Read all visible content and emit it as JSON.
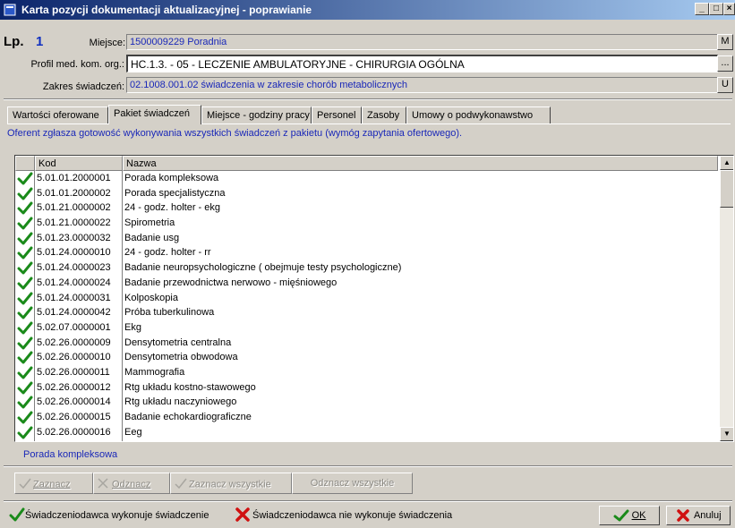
{
  "window": {
    "title": "Karta pozycji dokumentacji aktualizacyjnej - poprawianie",
    "controls": {
      "minimize": "_",
      "maximize": "□",
      "close": "×"
    }
  },
  "header": {
    "lp_label": "Lp.",
    "lp_value": "1",
    "miejsce_label": "Miejsce:",
    "miejsce_value": "1500009229 Poradnia",
    "miejsce_button": "M",
    "profil_label": "Profil med. kom. org.:",
    "profil_value": "HC.1.3. - 05 - LECZENIE AMBULATORYJNE - CHIRURGIA OGÓLNA",
    "profil_button": "...",
    "zakres_label": "Zakres świadczeń:",
    "zakres_value": "02.1008.001.02 świadczenia w zakresie chorób metabolicznych",
    "zakres_button": "U"
  },
  "tabs": [
    {
      "label": "Wartości oferowane"
    },
    {
      "label": "Pakiet świadczeń"
    },
    {
      "label": "Miejsce - godziny pracy"
    },
    {
      "label": "Personel"
    },
    {
      "label": "Zasoby"
    },
    {
      "label": "Umowy o podwykonawstwo"
    }
  ],
  "active_tab": "Pakiet świadczeń",
  "info_text": "Oferent zgłasza gotowość wykonywania wszystkich świadczeń z pakietu (wymóg zapytania ofertowego).",
  "table": {
    "columns": {
      "code": "Kod",
      "name": "Nazwa"
    },
    "rows": [
      {
        "code": "5.01.01.2000001",
        "name": "Porada kompleksowa",
        "checked": true
      },
      {
        "code": "5.01.01.2000002",
        "name": "Porada specjalistyczna",
        "checked": true
      },
      {
        "code": "5.01.21.0000002",
        "name": "24 - godz. holter - ekg",
        "checked": true
      },
      {
        "code": "5.01.21.0000022",
        "name": "Spirometria",
        "checked": true
      },
      {
        "code": "5.01.23.0000032",
        "name": "Badanie usg",
        "checked": true
      },
      {
        "code": "5.01.24.0000010",
        "name": "24 - godz. holter - rr",
        "checked": true
      },
      {
        "code": "5.01.24.0000023",
        "name": "Badanie neuropsychologiczne ( obejmuje testy psychologiczne)",
        "checked": true
      },
      {
        "code": "5.01.24.0000024",
        "name": "Badanie przewodnictwa nerwowo - mięśniowego",
        "checked": true
      },
      {
        "code": "5.01.24.0000031",
        "name": "Kolposkopia",
        "checked": true
      },
      {
        "code": "5.01.24.0000042",
        "name": "Próba tuberkulinowa",
        "checked": true
      },
      {
        "code": "5.02.07.0000001",
        "name": "Ekg",
        "checked": true
      },
      {
        "code": "5.02.26.0000009",
        "name": "Densytometria centralna",
        "checked": true
      },
      {
        "code": "5.02.26.0000010",
        "name": "Densytometria obwodowa",
        "checked": true
      },
      {
        "code": "5.02.26.0000011",
        "name": "Mammografia",
        "checked": true
      },
      {
        "code": "5.02.26.0000012",
        "name": "Rtg układu kostno-stawowego",
        "checked": true
      },
      {
        "code": "5.02.26.0000014",
        "name": "Rtg układu naczyniowego",
        "checked": true
      },
      {
        "code": "5.02.26.0000015",
        "name": "Badanie echokardiograficzne",
        "checked": true
      },
      {
        "code": "5.02.26.0000016",
        "name": "Eeg",
        "checked": true
      }
    ]
  },
  "selected_item": "Porada kompleksowa",
  "actions": {
    "zaznacz": "Zaznacz",
    "odznacz": "Odznacz",
    "zaznacz_wszystkie": "Zaznacz wszystkie",
    "odznacz_wszystkie": "Odznacz wszystkie"
  },
  "legend": {
    "performs": "Świadczeniodawca wykonuje świadczenie",
    "not_performs": "Świadczeniodawca nie wykonuje świadczenia"
  },
  "footer": {
    "ok": "OK",
    "cancel": "Anuluj"
  },
  "colors": {
    "check": "#1a8a1a",
    "cross": "#d01010",
    "blue_text": "#1a28b8",
    "title_bar": "#0a246a"
  }
}
